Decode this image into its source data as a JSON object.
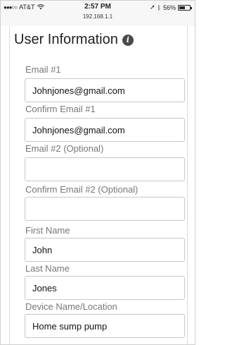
{
  "status_bar": {
    "carrier": "AT&T",
    "time": "2:57 PM",
    "address": "192.168.1.1",
    "battery": "56%",
    "battery_level": 0.56
  },
  "section": {
    "title": "User Information"
  },
  "fields": [
    {
      "label": "Email #1",
      "value": "Johnjones@gmail.com"
    },
    {
      "label": "Confirm Email #1",
      "value": "Johnjones@gmail.com"
    },
    {
      "label": "Email #2 (Optional)",
      "value": ""
    },
    {
      "label": "Confirm Email #2 (Optional)",
      "value": ""
    },
    {
      "label": "First Name",
      "value": "John"
    },
    {
      "label": "Last Name",
      "value": "Jones"
    },
    {
      "label": "Device Name/Location",
      "value": "Home sump pump"
    }
  ]
}
